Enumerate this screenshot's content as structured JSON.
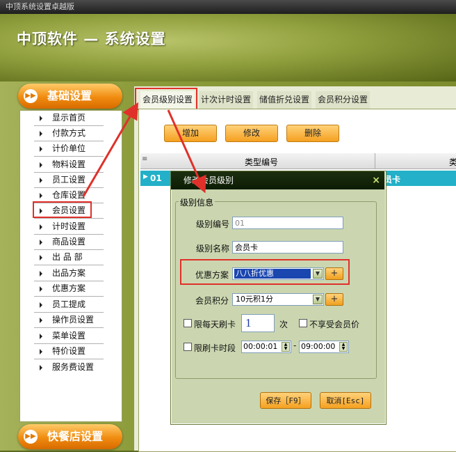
{
  "window": {
    "title": "中顶系统设置卓越版"
  },
  "header": {
    "title": "中顶软件 — 系统设置"
  },
  "sidebar": {
    "basic_header": "基础设置",
    "items": [
      {
        "label": "显示首页"
      },
      {
        "label": "付款方式"
      },
      {
        "label": "计价单位"
      },
      {
        "label": "物料设置"
      },
      {
        "label": "员工设置"
      },
      {
        "label": "仓库设置"
      },
      {
        "label": "会员设置"
      },
      {
        "label": "计时设置"
      },
      {
        "label": "商品设置"
      },
      {
        "label": "出 品 部"
      },
      {
        "label": "出品方案"
      },
      {
        "label": "优惠方案"
      },
      {
        "label": "员工提成"
      },
      {
        "label": "操作员设置"
      },
      {
        "label": "菜单设置"
      },
      {
        "label": "特价设置"
      },
      {
        "label": "服务费设置"
      }
    ],
    "fastfood_header": "快餐店设置"
  },
  "tabs": [
    {
      "label": "会员级别设置"
    },
    {
      "label": "计次计时设置"
    },
    {
      "label": "储值折兑设置"
    },
    {
      "label": "会员积分设置"
    }
  ],
  "toolbar": {
    "add": "增加",
    "edit": "修改",
    "delete": "删除"
  },
  "grid": {
    "col_type_code": "类型编号",
    "col_partial": "类",
    "row": {
      "code": "01",
      "name_partial": "员卡"
    }
  },
  "dialog": {
    "title": "修改会员级别",
    "group_title": "级别信息",
    "level_code_label": "级别编号",
    "level_code_value": "01",
    "level_name_label": "级别名称",
    "level_name_value": "会员卡",
    "discount_label": "优惠方案",
    "discount_value": "八八折优惠",
    "points_label": "会员积分",
    "points_value": "10元积1分",
    "daily_limit_label": "限每天刷卡",
    "daily_limit_value": "1",
    "times_unit": "次",
    "no_member_price_label": "不享受会员价",
    "time_limit_label": "限刷卡时段",
    "time_start": "00:00:01",
    "time_sep": "-",
    "time_end": "09:00:00",
    "save": "保存［F9］",
    "cancel": "取消[Esc]",
    "close_glyph": "×",
    "plus_glyph": "+"
  },
  "colors": {
    "accent_orange": "#f5a020",
    "highlight_red": "#e0302a",
    "selection_teal": "#23b0c8",
    "header_green": "#8f9e3c"
  }
}
